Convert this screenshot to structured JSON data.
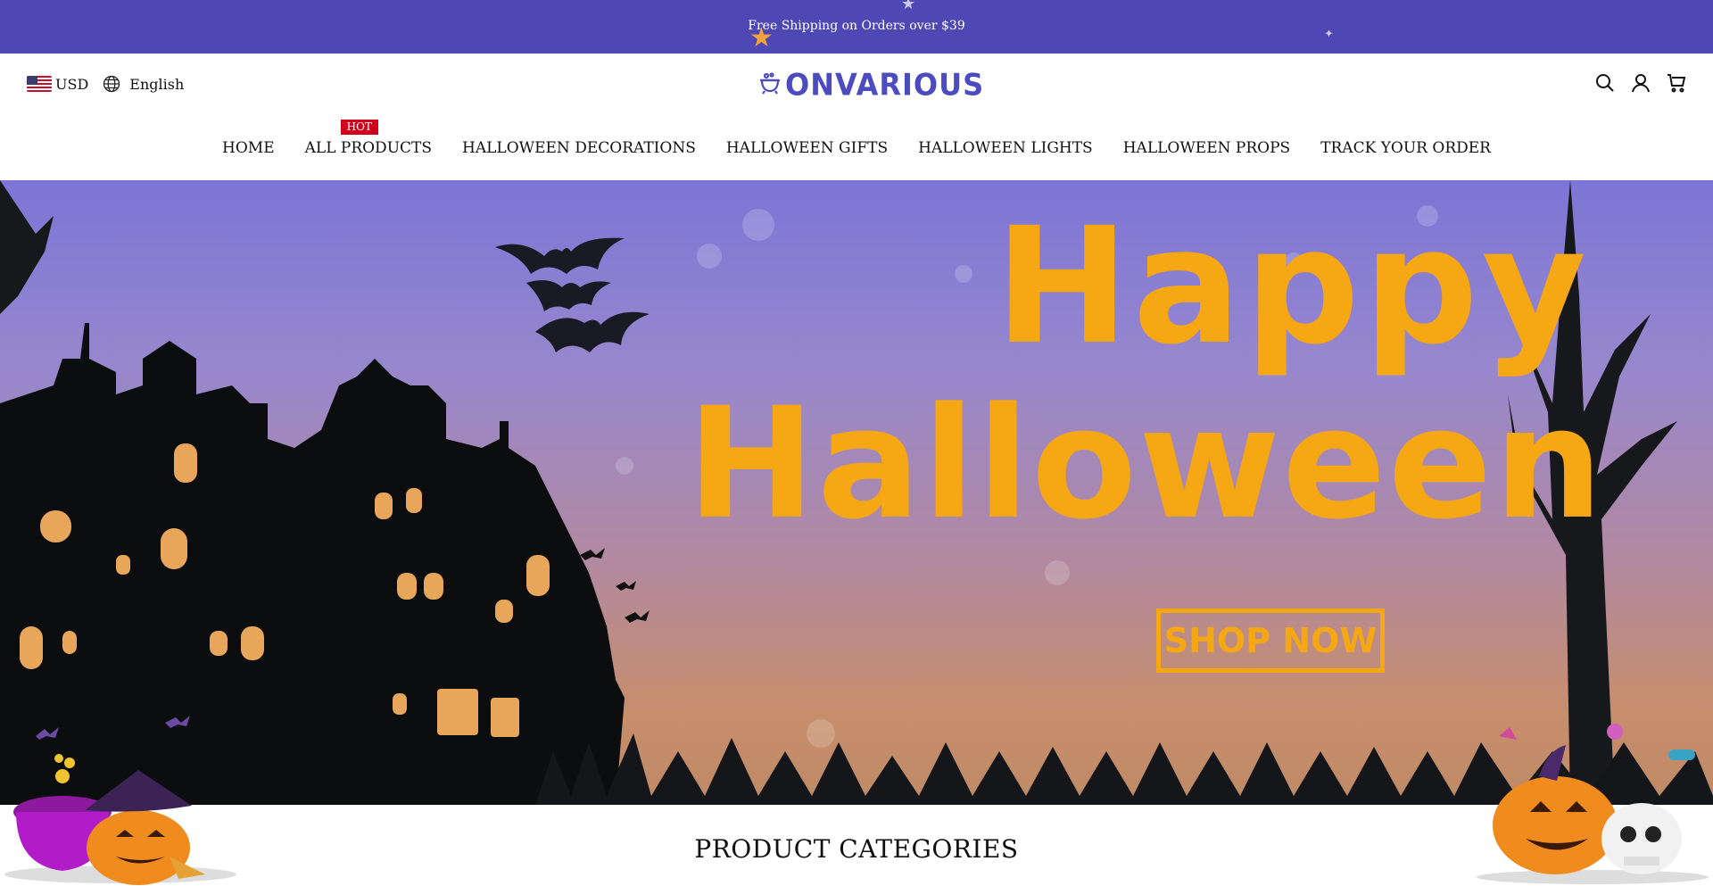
{
  "announcement": {
    "text": "Free Shipping on Orders over $39"
  },
  "header": {
    "currency": "USD",
    "language": "English",
    "logo_text": "ONVARIOUS",
    "brand_color": "#4c4cc0"
  },
  "nav": {
    "items": [
      {
        "label": "HOME"
      },
      {
        "label": "ALL PRODUCTS",
        "badge": "HOT"
      },
      {
        "label": "HALLOWEEN DECORATIONS"
      },
      {
        "label": "HALLOWEEN GIFTS"
      },
      {
        "label": "HALLOWEEN LIGHTS"
      },
      {
        "label": "HALLOWEEN PROPS"
      },
      {
        "label": "TRACK YOUR ORDER"
      }
    ]
  },
  "hero": {
    "title_line1": "Happy",
    "title_line2": "Halloween",
    "cta": "SHOP NOW",
    "close_icon": "×",
    "accent_color": "#f6a714"
  },
  "sections": {
    "categories_title": "PRODUCT CATEGORIES"
  },
  "icons": [
    "us-flag-icon",
    "globe-icon",
    "logo-cauldron-icon",
    "search-icon",
    "user-icon",
    "cart-icon",
    "close-icon"
  ]
}
